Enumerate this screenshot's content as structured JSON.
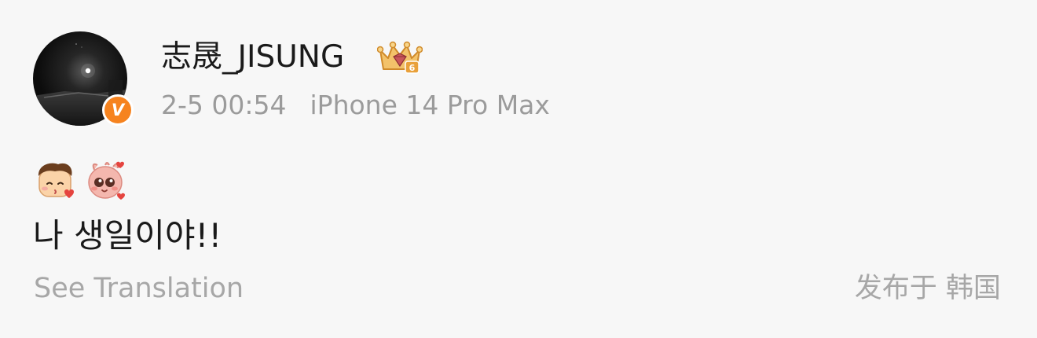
{
  "post": {
    "author": {
      "name": "志晟_JISUNG",
      "verified_glyph": "V",
      "verified_color": "#f6831f",
      "vip_badge_level": "6"
    },
    "meta": {
      "time": "2-5 00:54",
      "device": "iPhone 14 Pro Max"
    },
    "emojis": [
      "kiss-boy-emoji",
      "pink-creature-heart-emoji"
    ],
    "text": "나 생일이야!!",
    "translate_label": "See Translation",
    "location": "发布于 韩国"
  },
  "colors": {
    "background": "#f7f7f7",
    "primary_text": "#1a1a1a",
    "secondary_text": "#9b9b9b",
    "accent_orange": "#f6831f"
  }
}
